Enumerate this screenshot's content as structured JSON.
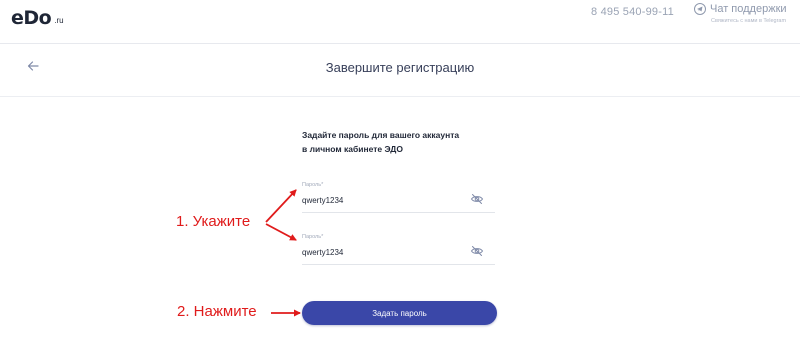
{
  "header": {
    "logo_mark": "eDo",
    "logo_suffix": ".ru",
    "phone": "8 495 540-99-11",
    "support_label": "Чат поддержки",
    "support_sub": "Свяжитесь с нами в Telegram"
  },
  "page": {
    "title": "Завершите регистрацию"
  },
  "form": {
    "description_line1": "Задайте пароль для вашего аккаунта",
    "description_line2": "в личном кабинете ЭДО",
    "fields": [
      {
        "label": "Пароль*",
        "value": "qwerty1234"
      },
      {
        "label": "Пароль*",
        "value": "qwerty1234"
      }
    ],
    "submit_label": "Задать пароль"
  },
  "annotations": {
    "step1": "1. Укажите",
    "step2": "2. Нажмите"
  },
  "colors": {
    "accent": "#3a47a8",
    "annotation": "#e01b1b"
  },
  "icons": {
    "back": "arrow-left-icon",
    "support": "telegram-icon",
    "password_toggle": "eye-off-icon"
  }
}
